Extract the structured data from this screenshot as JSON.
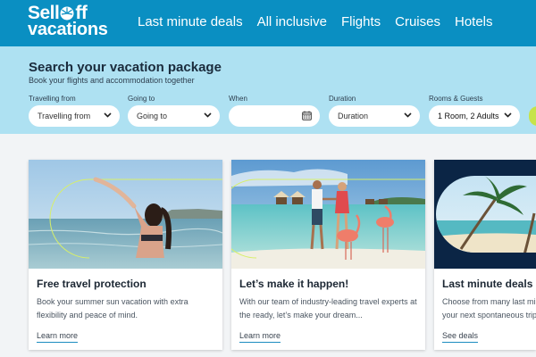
{
  "brand": {
    "line1": "Selloff",
    "line2": "vacations"
  },
  "nav": [
    {
      "label": "Last minute deals"
    },
    {
      "label": "All inclusive"
    },
    {
      "label": "Flights"
    },
    {
      "label": "Cruises"
    },
    {
      "label": "Hotels"
    }
  ],
  "search": {
    "title": "Search your vacation package",
    "subtitle": "Book your flights and accommodation together",
    "fields": [
      {
        "label": "Travelling from",
        "value": "Travelling from"
      },
      {
        "label": "Going to",
        "value": "Going to"
      },
      {
        "label": "When",
        "value": ""
      },
      {
        "label": "Duration",
        "value": "Duration"
      },
      {
        "label": "Rooms & Guests",
        "value": "1 Room, 2 Adults"
      }
    ]
  },
  "cards": [
    {
      "title": "Free travel protection",
      "text": "Book your summer sun vacation with extra flexibility and peace of mind.",
      "link": "Learn more"
    },
    {
      "title": "Let’s make it happen!",
      "text": "With our team of industry-leading travel experts at the ready, let’s make your dream...",
      "link": "Learn more"
    },
    {
      "title": "Last minute deals",
      "text": "Choose from many last minute deals and book your next spontaneous trip.",
      "link": "See deals"
    }
  ],
  "colors": {
    "header": "#0a8fc2",
    "search_band": "#aee1f2",
    "accent_line": "#1c8cc0",
    "cta": "#c6e34a"
  }
}
